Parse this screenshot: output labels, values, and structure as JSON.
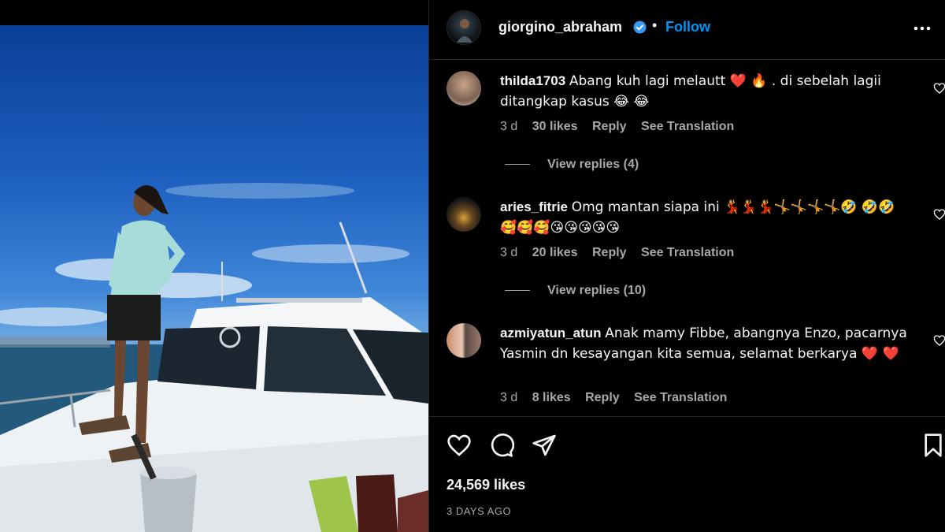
{
  "post": {
    "username": "giorgino_abraham",
    "separator": "•",
    "follow_label": "Follow"
  },
  "comments": [
    {
      "username": "thilda1703",
      "text": "Abang kuh lagi melautt ❤️ 🔥 . di sebelah lagii ditangkap kasus 😂 😂",
      "time": "3 d",
      "likes": "30 likes",
      "reply": "Reply",
      "translate": "See Translation",
      "view_replies": "View replies (4)"
    },
    {
      "username": "aries_fitrie",
      "text": "Omg mantan siapa ini 💃💃💃🤸🤸🤸🤸🤣 🤣🤣🥰🥰🥰😘😘😘😘😘",
      "time": "3 d",
      "likes": "20 likes",
      "reply": "Reply",
      "translate": "See Translation",
      "view_replies": "View replies (10)"
    },
    {
      "username": "azmiyatun_atun",
      "text": "Anak mamy Fibbe, abangnya Enzo, pacarnya Yasmin dn kesayangan kita semua, selamat berkarya ❤️ ❤️",
      "time": "3 d",
      "likes": "8 likes",
      "reply": "Reply",
      "translate": "See Translation"
    }
  ],
  "footer": {
    "likes_count": "24,569 likes",
    "date": "3 DAYS AGO"
  },
  "colors": {
    "background": "#000000",
    "accent": "#0095f6",
    "muted": "#a8a8a8",
    "divider": "#262626",
    "heart_red": "#e0245e"
  },
  "icons": [
    "verified-icon",
    "more-options-icon",
    "heart-icon",
    "comment-icon",
    "share-icon",
    "bookmark-icon"
  ]
}
